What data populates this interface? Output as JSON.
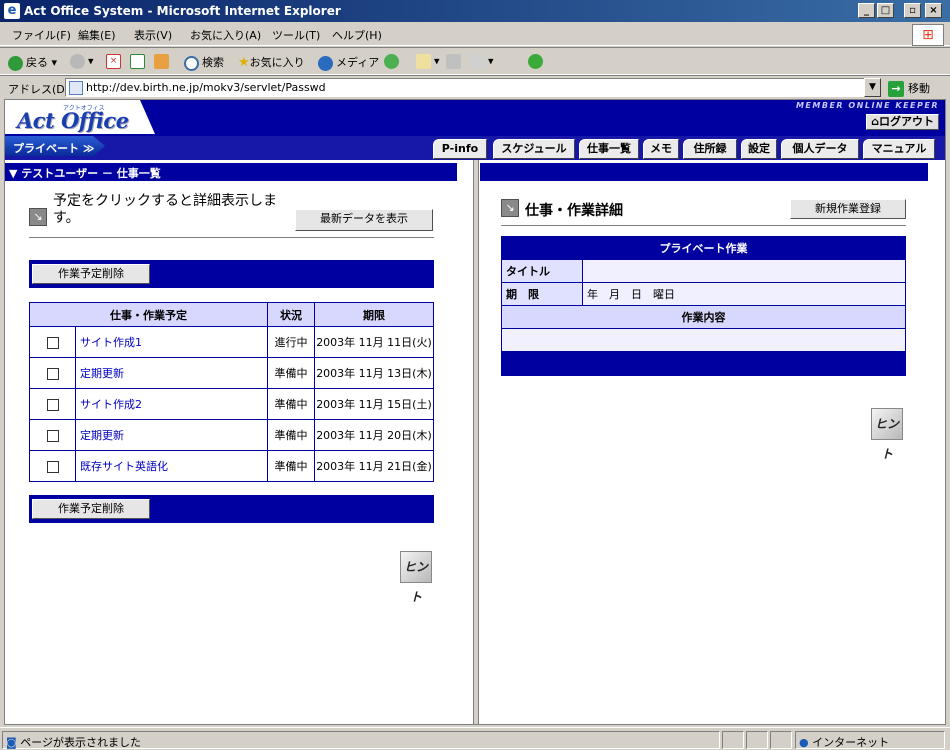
{
  "window": {
    "title": "Act Office System - Microsoft Internet Explorer"
  },
  "menu": [
    "ファイル(F)",
    "編集(E)",
    "表示(V)",
    "お気に入り(A)",
    "ツール(T)",
    "ヘルプ(H)"
  ],
  "toolbar": {
    "back": "戻る",
    "search": "検索",
    "favorites": "お気に入り",
    "media": "メディア"
  },
  "address": {
    "label": "アドレス(D)",
    "url": "http://dev.birth.ne.jp/mokv3/servlet/Passwd",
    "go": "移動"
  },
  "header": {
    "logo": "Act Office",
    "logo_ruby": "アクトオフィス",
    "tagline": "MEMBER ONLINE KEEPER",
    "logout": "ログアウト",
    "private_label": "プライベート"
  },
  "nav": [
    "P-info",
    "スケジュール",
    "仕事一覧",
    "メモ",
    "住所録",
    "設定",
    "個人データ",
    "マニュアル"
  ],
  "left": {
    "pane_title": "▼ テストユーザー － 仕事一覧",
    "instruction": "予定をクリックすると詳細表示します。",
    "refresh_button": "最新データを表示",
    "delete_button": "作業予定削除",
    "table_headers": [
      "仕事・作業予定",
      "状況",
      "期限"
    ],
    "rows": [
      {
        "title": "サイト作成1",
        "status": "進行中",
        "due": "2003年 11月 11日(火)"
      },
      {
        "title": "定期更新",
        "status": "準備中",
        "due": "2003年 11月 13日(木)"
      },
      {
        "title": "サイト作成2",
        "status": "準備中",
        "due": "2003年 11月 15日(土)"
      },
      {
        "title": "定期更新",
        "status": "準備中",
        "due": "2003年 11月 20日(木)"
      },
      {
        "title": "既存サイト英語化",
        "status": "準備中",
        "due": "2003年 11月 21日(金)"
      }
    ],
    "hint": "ヒント"
  },
  "right": {
    "section_title": "仕事・作業詳細",
    "new_button": "新規作業登録",
    "table_title": "プライベート作業",
    "title_label": "タイトル",
    "due_label": "期　限",
    "due_value": "年　月　日　曜日",
    "content_label": "作業内容",
    "hint": "ヒント"
  },
  "status": {
    "text": "ページが表示されました",
    "zone": "インターネット"
  }
}
